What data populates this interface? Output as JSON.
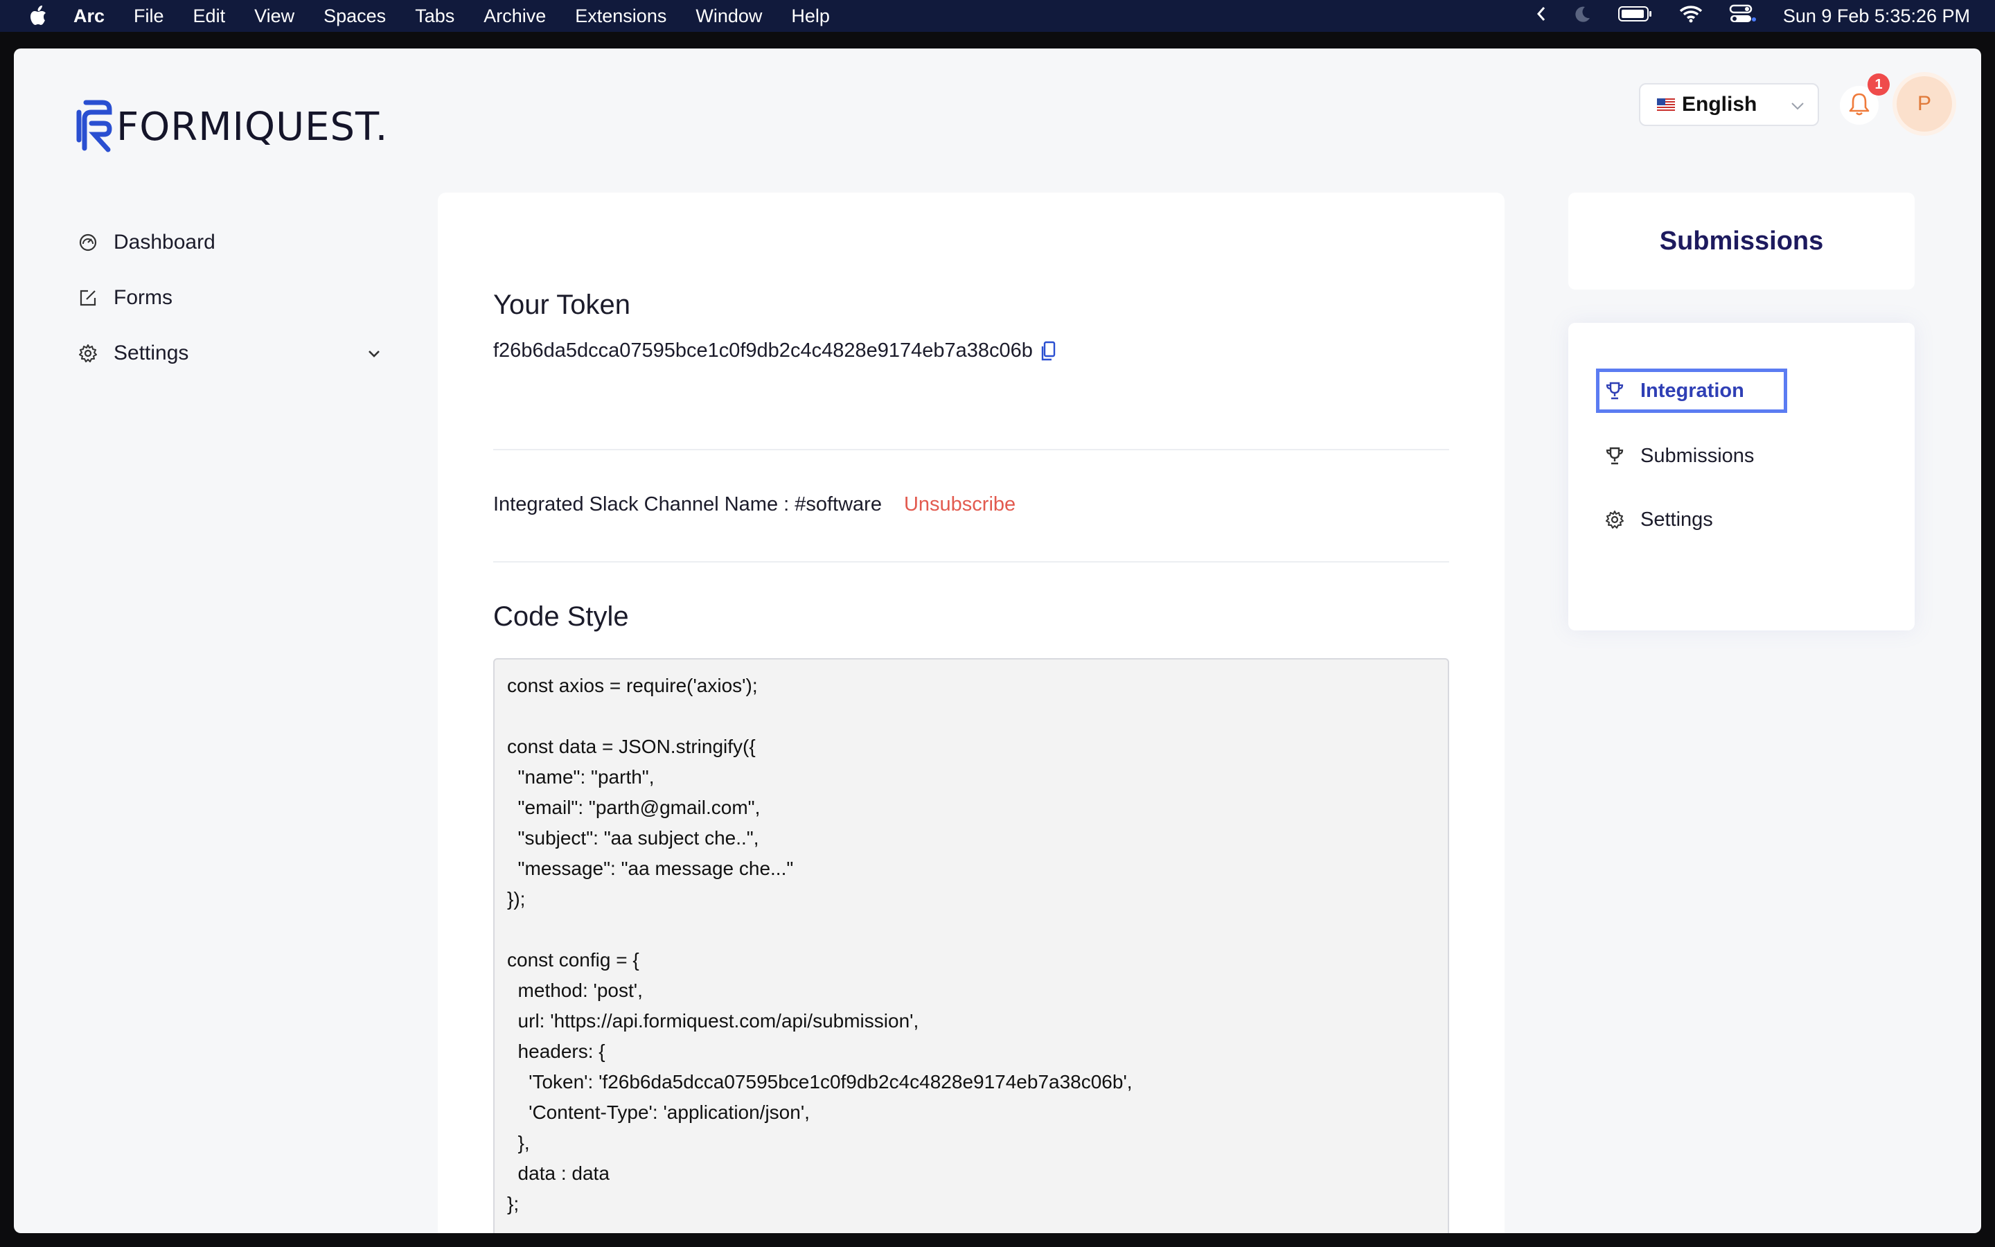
{
  "menubar": {
    "app_name": "Arc",
    "items": [
      "File",
      "Edit",
      "View",
      "Spaces",
      "Tabs",
      "Archive",
      "Extensions",
      "Window",
      "Help"
    ],
    "datetime": "Sun 9 Feb  5:35:26 PM"
  },
  "brand": {
    "logo_text": "FORMIQUEST."
  },
  "header": {
    "language": "English",
    "notification_count": "1",
    "avatar_initial": "P"
  },
  "sidebar": {
    "items": [
      {
        "label": "Dashboard",
        "icon": "dashboard-gauge-icon"
      },
      {
        "label": "Forms",
        "icon": "edit-form-icon"
      },
      {
        "label": "Settings",
        "icon": "gear-icon"
      }
    ]
  },
  "main": {
    "token_title": "Your Token",
    "token_value": "f26b6da5dcca07595bce1c0f9db2c4c4828e9174eb7a38c06b",
    "slack_label": "Integrated Slack Channel Name : #software",
    "unsubscribe_label": "Unsubscribe",
    "code_title": "Code Style",
    "code_snippet": "const axios = require('axios');\n\nconst data = JSON.stringify({\n  \"name\": \"parth\",\n  \"email\": \"parth@gmail.com\",\n  \"subject\": \"aa subject che..\",\n  \"message\": \"aa message che...\"\n});\n\nconst config = {\n  method: 'post',\n  url: 'https://api.formiquest.com/api/submission',\n  headers: {\n    'Token': 'f26b6da5dcca07595bce1c0f9db2c4c4828e9174eb7a38c06b',\n    'Content-Type': 'application/json',\n  },\n  data : data\n};\n\naxios.request(config)"
  },
  "right_panel": {
    "title": "Submissions",
    "menu": [
      {
        "label": "Integration",
        "icon": "trophy-icon",
        "active": true
      },
      {
        "label": "Submissions",
        "icon": "trophy-icon",
        "active": false
      },
      {
        "label": "Settings",
        "icon": "gear-icon",
        "active": false
      }
    ]
  },
  "colors": {
    "accent": "#2f3fb5",
    "danger": "#e25a4f",
    "brand_blue": "#2a4fd1"
  }
}
